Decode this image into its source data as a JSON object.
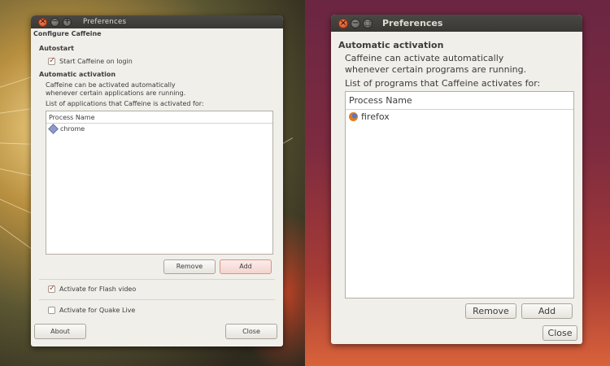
{
  "left": {
    "window_title": "Preferences",
    "window_controls": {
      "close": "×",
      "minimize": "−",
      "maximize": "+"
    },
    "heading": "Configure Caffeine",
    "autostart_section": "Autostart",
    "start_on_login": {
      "label": "Start Caffeine on login",
      "checked": true
    },
    "auto_section": "Automatic activation",
    "auto_desc_1": "Caffeine can be activated automatically",
    "auto_desc_2": "whenever certain applications are running.",
    "list_label": "List of applications that Caffeine is activated for:",
    "column_header": "Process Name",
    "rows": [
      {
        "name": "chrome",
        "icon": "diamond-app-icon"
      }
    ],
    "remove_label": "Remove",
    "add_label": "Add",
    "flash": {
      "label": "Activate for Flash video",
      "checked": true
    },
    "quake": {
      "label": "Activate for Quake Live",
      "checked": false
    },
    "about_label": "About",
    "close_label": "Close"
  },
  "right": {
    "window_title": "Preferences",
    "window_controls": {
      "close": "×",
      "minimize": "−",
      "maximize": "□"
    },
    "auto_section": "Automatic activation",
    "auto_desc_1": "Caffeine can activate automatically",
    "auto_desc_2": "whenever certain programs are running.",
    "list_label": "List of programs that Caffeine activates for:",
    "column_header": "Process Name",
    "rows": [
      {
        "name": "firefox",
        "icon": "firefox-icon"
      }
    ],
    "remove_label": "Remove",
    "add_label": "Add",
    "close_label": "Close"
  },
  "colors": {
    "accent": "#d8461b",
    "left_desktop": "#b99040",
    "right_desktop": "#7d2b40"
  }
}
